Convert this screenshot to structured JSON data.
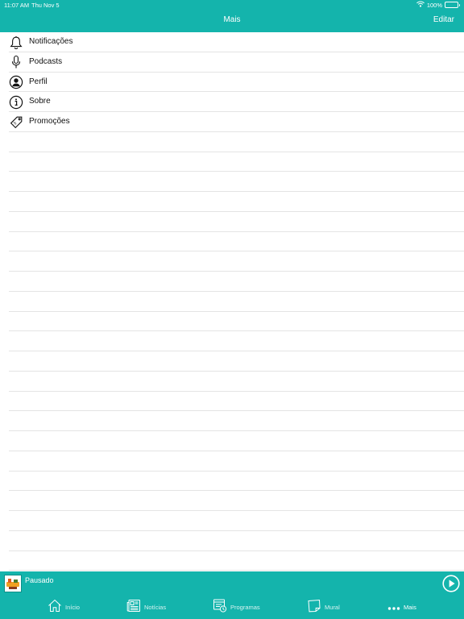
{
  "status_bar": {
    "time": "11:07 AM",
    "date": "Thu Nov 5",
    "battery": "100%"
  },
  "nav": {
    "title": "Mais",
    "edit_label": "Editar"
  },
  "menu": {
    "items": [
      {
        "label": "Notificações",
        "icon": "bell-icon"
      },
      {
        "label": "Podcasts",
        "icon": "microphone-icon"
      },
      {
        "label": "Perfil",
        "icon": "profile-icon"
      },
      {
        "label": "Sobre",
        "icon": "info-icon"
      },
      {
        "label": "Promoções",
        "icon": "tag-icon"
      }
    ]
  },
  "player": {
    "status": "Pausado"
  },
  "tabs": [
    {
      "label": "Início",
      "icon": "home-icon"
    },
    {
      "label": "Notícias",
      "icon": "newspaper-icon"
    },
    {
      "label": "Programas",
      "icon": "calendar-icon"
    },
    {
      "label": "Mural",
      "icon": "note-icon"
    },
    {
      "label": "Mais",
      "icon": "more-dots-icon",
      "active": true
    }
  ],
  "colors": {
    "accent": "#14b4ac",
    "separator": "#e4e4e4",
    "text": "#111111"
  }
}
